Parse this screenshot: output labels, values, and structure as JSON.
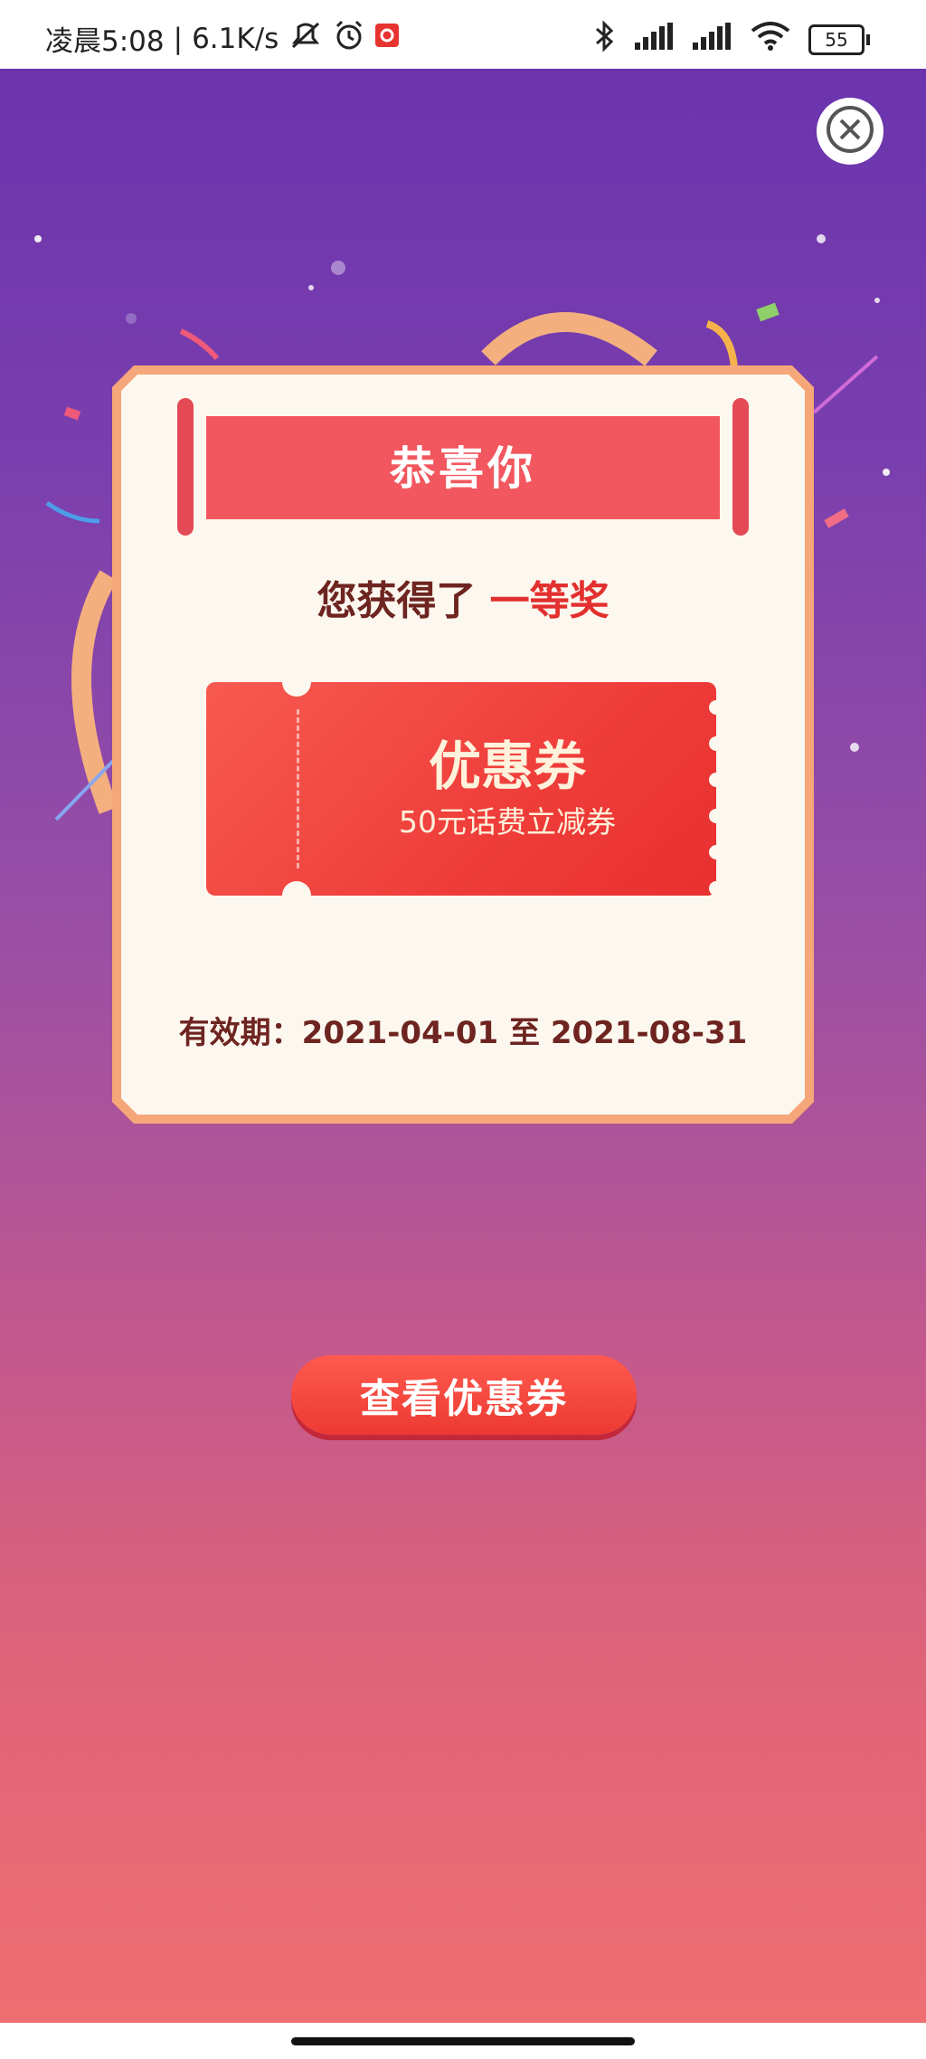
{
  "status_bar": {
    "time": "凌晨5:08",
    "net_speed": "6.1K/s",
    "battery": "55"
  },
  "popup": {
    "title": "恭喜你",
    "result_prefix": "您获得了",
    "prize": "一等奖",
    "coupon": {
      "title": "优惠券",
      "description": "50元话费立减券"
    },
    "validity": "有效期：2021-04-01 至 2021-08-31"
  },
  "view_button": {
    "label": "查看优惠券"
  },
  "icons": {
    "close": "close-icon",
    "bluetooth": "bluetooth-icon",
    "signal": "signal-icon",
    "wifi": "wifi-icon",
    "battery": "battery-icon",
    "alarm": "alarm-icon",
    "mute": "mute-icon"
  },
  "colors": {
    "background_top": "#6b34ad",
    "background_bottom": "#ee6e72",
    "accent_red": "#f2575f",
    "prize_red": "#e2302f",
    "text_dark": "#6e2420"
  }
}
